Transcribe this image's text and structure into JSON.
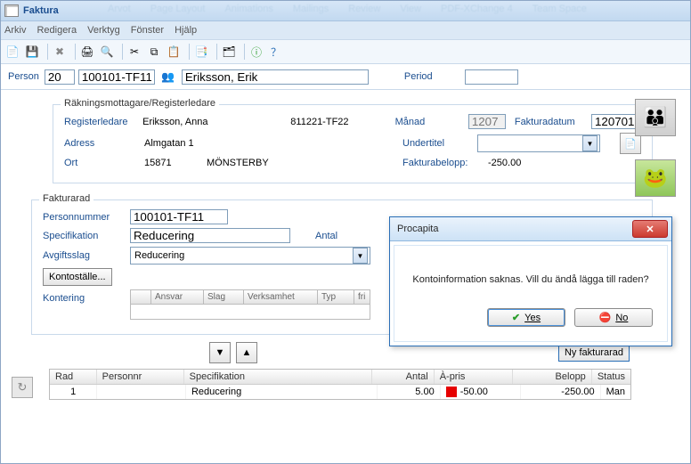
{
  "window": {
    "title": "Faktura"
  },
  "menu": {
    "arkiv": "Arkiv",
    "redigera": "Redigera",
    "verktyg": "Verktyg",
    "fonster": "Fönster",
    "hjalp": "Hjälp"
  },
  "top": {
    "person_lbl": "Person",
    "person_no": "20",
    "person_id": "100101-TF11",
    "person_name": "Eriksson, Erik",
    "period_lbl": "Period",
    "period_val": ""
  },
  "reg": {
    "legend": "Räkningsmottagare/Registerledare",
    "lbl_regled": "Registerledare",
    "regled_name": "Eriksson, Anna",
    "regled_pn": "811221-TF22",
    "lbl_adress": "Adress",
    "adress": "Almgatan 1",
    "lbl_ort": "Ort",
    "ort_code": "15871",
    "ort_name": "MÖNSTERBY",
    "lbl_manad": "Månad",
    "manad": "1207",
    "lbl_fdatum": "Fakturadatum",
    "fdatum": "120701",
    "lbl_undertitel": "Undertitel",
    "undertitel": "",
    "lbl_fbelopp": "Fakturabelopp:",
    "fbelopp": "-250.00"
  },
  "rad": {
    "legend": "Fakturarad",
    "lbl_pnr": "Personnummer",
    "pnr": "100101-TF11",
    "lbl_spec": "Specifikation",
    "spec": "Reducering",
    "lbl_antal": "Antal",
    "lbl_avgslag": "Avgiftsslag",
    "avgslag": "Reducering",
    "btn_konto": "Kontoställe...",
    "lbl_kont": "Kontering",
    "cols": {
      "ansvar": "Ansvar",
      "slag": "Slag",
      "verksamhet": "Verksamhet",
      "typ": "Typ",
      "fri": "fri"
    },
    "btn_ny": "Ny fakturarad"
  },
  "table": {
    "h_rad": "Rad",
    "h_pnr": "Personnr",
    "h_spec": "Specifikation",
    "h_antal": "Antal",
    "h_apris": "À-pris",
    "h_belopp": "Belopp",
    "h_status": "Status",
    "r_rad": "1",
    "r_pnr": "",
    "r_spec": "Reducering",
    "r_antal": "5.00",
    "r_apris": "-50.00",
    "r_belopp": "-250.00",
    "r_status": "Man"
  },
  "dialog": {
    "title": "Procapita",
    "msg": "Kontoinformation saknas. Vill du ändå lägga till raden?",
    "yes": "Yes",
    "no": "No"
  }
}
